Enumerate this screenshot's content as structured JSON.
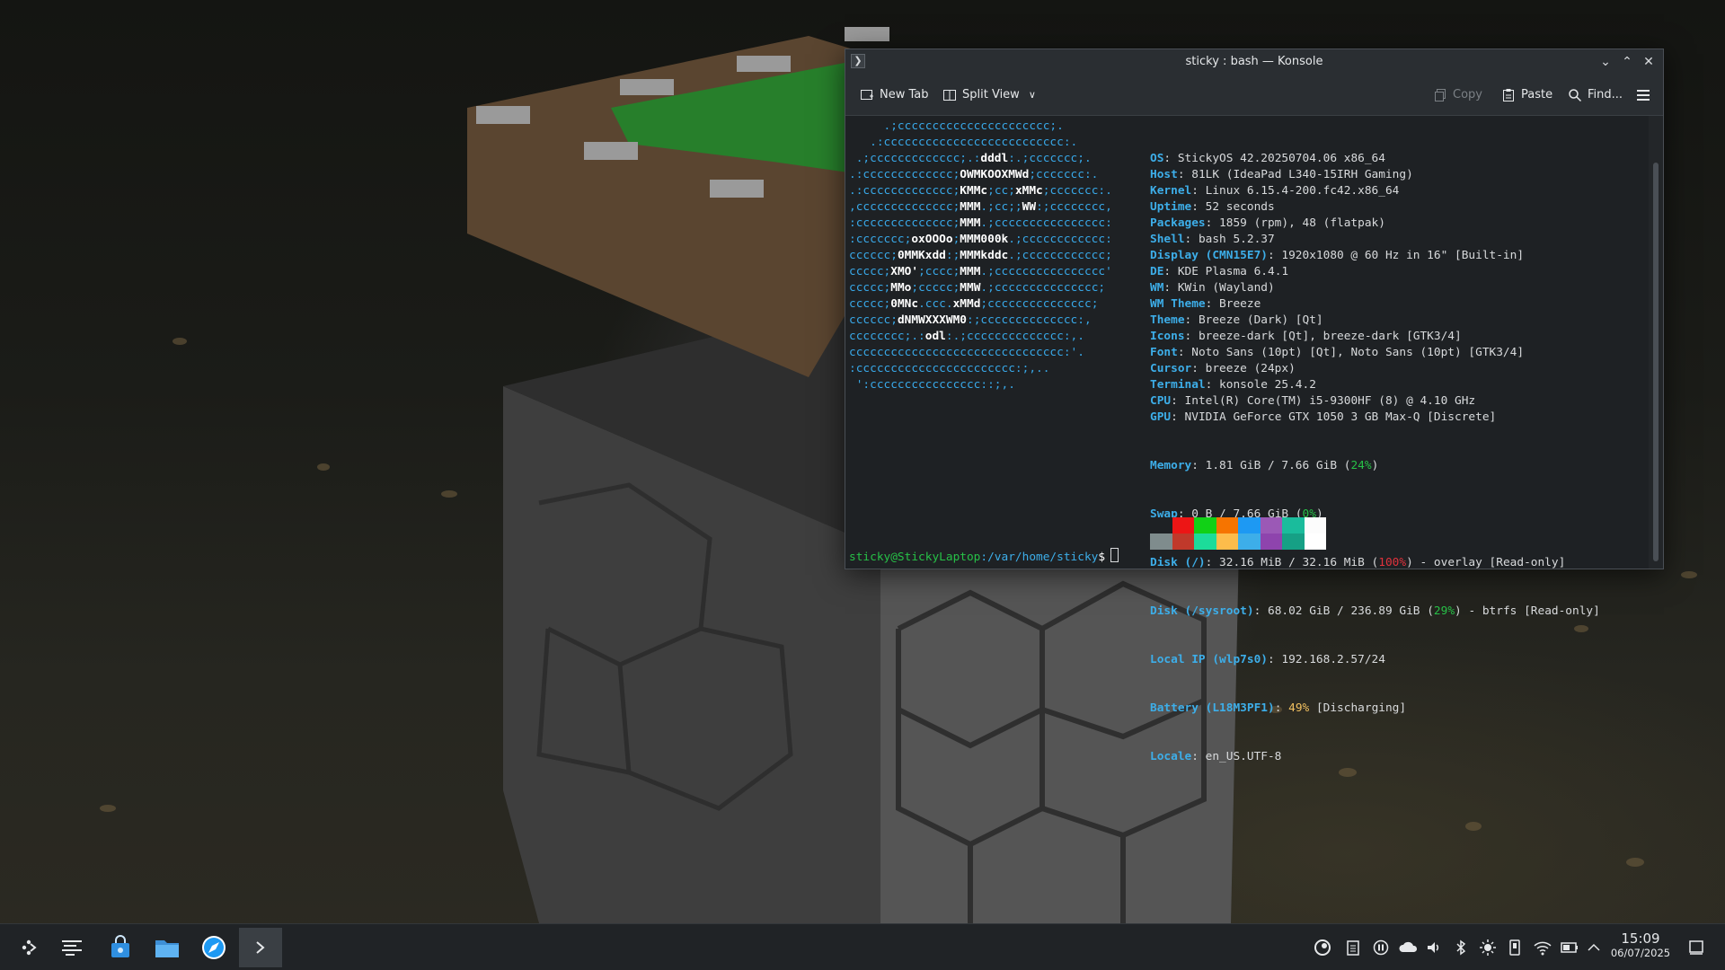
{
  "window": {
    "title": "sticky : bash — Konsole",
    "app_icon": "terminal-icon"
  },
  "toolbar": {
    "new_tab_label": "New Tab",
    "split_view_label": "Split View",
    "copy_label": "Copy",
    "paste_label": "Paste",
    "find_label": "Find..."
  },
  "terminal": {
    "logo_lines": [
      "     .;cccccccccccccccccccccc;.",
      "   .:cccccccccccccccccccccccccc:.",
      " .;ccccccccccccc;.:dddl:.;ccccccc;.",
      ".:ccccccccccccc;OWMKOOXMWd;ccccccc:.",
      ".:ccccccccccccc;KMMc;cc;xMMc;ccccccc:.",
      ",cccccccccccccc;MMM.;cc;;WW:;cccccccc,",
      ":cccccccccccccc;MMM.;cccccccccccccccc:",
      ":ccccccc;oxOOOo;MMM000k.;cccccccccccc:",
      "cccccc;0MMKxdd:;MMMkddc.;cccccccccccc;",
      "ccccc;XMO';cccc;MMM.;cccccccccccccccc'",
      "ccccc;MMo;ccccc;MMW.;ccccccccccccccc;",
      "ccccc;0MNc.ccc.xMMd;ccccccccccccccc;",
      "cccccc;dNMWXXXWM0:;cccccccccccccc:,",
      "cccccccc;.:odl:.;cccccccccccccc:,.",
      "ccccccccccccccccccccccccccccccc:'.",
      ":ccccccccccccccccccccccc:;,..",
      " ':cccccccccccccccc::;,."
    ],
    "info": [
      {
        "k": "OS",
        "v": ": StickyOS 42.20250704.06 x86_64"
      },
      {
        "k": "Host",
        "v": ": 81LK (IdeaPad L340-15IRH Gaming)"
      },
      {
        "k": "Kernel",
        "v": ": Linux 6.15.4-200.fc42.x86_64"
      },
      {
        "k": "Uptime",
        "v": ": 52 seconds"
      },
      {
        "k": "Packages",
        "v": ": 1859 (rpm), 48 (flatpak)"
      },
      {
        "k": "Shell",
        "v": ": bash 5.2.37"
      },
      {
        "k": "Display (CMN15E7)",
        "v": ": 1920x1080 @ 60 Hz in 16\" [Built-in]"
      },
      {
        "k": "DE",
        "v": ": KDE Plasma 6.4.1"
      },
      {
        "k": "WM",
        "v": ": KWin (Wayland)"
      },
      {
        "k": "WM Theme",
        "v": ": Breeze"
      },
      {
        "k": "Theme",
        "v": ": Breeze (Dark) [Qt]"
      },
      {
        "k": "Icons",
        "v": ": breeze-dark [Qt], breeze-dark [GTK3/4]"
      },
      {
        "k": "Font",
        "v": ": Noto Sans (10pt) [Qt], Noto Sans (10pt) [GTK3/4]"
      },
      {
        "k": "Cursor",
        "v": ": breeze (24px)"
      },
      {
        "k": "Terminal",
        "v": ": konsole 25.4.2"
      },
      {
        "k": "CPU",
        "v": ": Intel(R) Core(TM) i5-9300HF (8) @ 4.10 GHz"
      },
      {
        "k": "GPU",
        "v": ": NVIDIA GeForce GTX 1050 3 GB Max-Q [Discrete]"
      }
    ],
    "memory": {
      "k": "Memory",
      "pre": ": 1.81 GiB / 7.66 GiB (",
      "pct": "24%",
      "post": ")"
    },
    "swap": {
      "k": "Swap",
      "pre": ": 0 B / 7.66 GiB (",
      "pct": "0%",
      "post": ")"
    },
    "disk_root": {
      "k": "Disk (/)",
      "pre": ": 32.16 MiB / 32.16 MiB (",
      "pct": "100%",
      "post": ") - overlay [Read-only]"
    },
    "disk_sysroot": {
      "k": "Disk (/sysroot)",
      "pre": ": 68.02 GiB / 236.89 GiB (",
      "pct": "29%",
      "post": ") - btrfs [Read-only]"
    },
    "local_ip": {
      "k": "Local IP (wlp7s0)",
      "v": ": 192.168.2.57/24"
    },
    "battery": {
      "k": "Battery (L18M3PF1)",
      "pre": ": ",
      "pct": "49%",
      "post": " [Discharging]"
    },
    "locale": {
      "k": "Locale",
      "v": ": en_US.UTF-8"
    },
    "palette_top": [
      "#1e2124",
      "#ed1515",
      "#11d116",
      "#f67400",
      "#1d99f3",
      "#9b59b6",
      "#1abc9c",
      "#fcfcfc"
    ],
    "palette_bottom": [
      "#7f8c8d",
      "#c0392b",
      "#1cdc9a",
      "#fdbc4b",
      "#3daee9",
      "#8e44ad",
      "#16a085",
      "#ffffff"
    ],
    "prompt_user": "sticky@StickyLaptop",
    "prompt_path": ":/var/home/sticky",
    "prompt_symbol": "$"
  },
  "taskbar": {
    "clock_time": "15:09",
    "clock_date": "06/07/2025",
    "launchers": [
      "app-launcher-icon",
      "pager-icon",
      "discover-store-icon",
      "file-manager-icon",
      "browser-icon",
      "konsole-task-icon"
    ],
    "tray_icons": [
      "steam-icon",
      "clipboard-icon",
      "media-pause-icon",
      "cloud-icon",
      "volume-icon",
      "bluetooth-icon",
      "brightness-icon",
      "storage-device-icon",
      "wifi-icon",
      "battery-icon",
      "tray-expand-icon",
      "show-desktop-icon"
    ]
  },
  "colors": {
    "accent": "#3daee9",
    "logo": "#38a8e8",
    "green": "#27c147",
    "red": "#e0323c",
    "yellow": "#f0c060"
  }
}
